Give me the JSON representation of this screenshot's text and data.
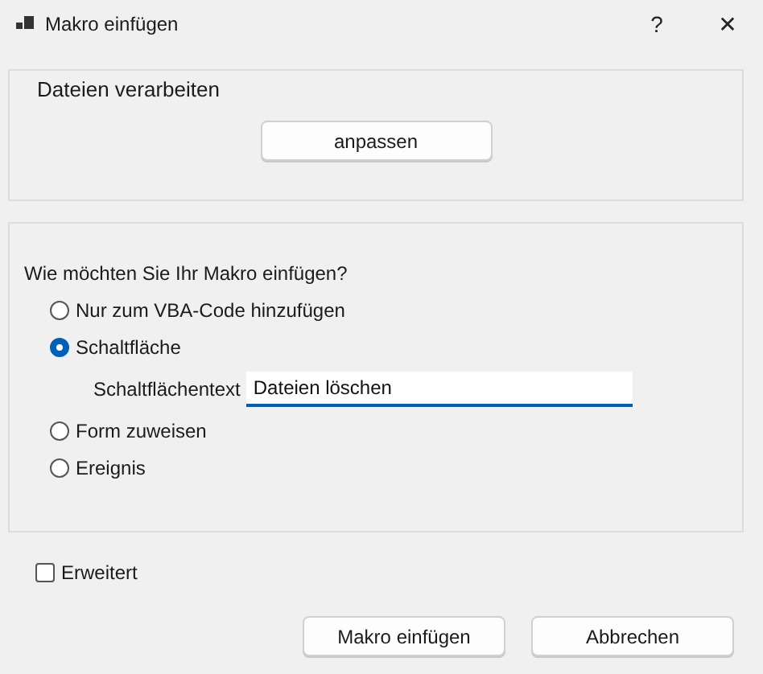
{
  "window": {
    "title": "Makro einfügen",
    "help": "?",
    "close": "✕"
  },
  "group": {
    "title": "Dateien verarbeiten",
    "button": "anpassen"
  },
  "placement": {
    "question": "Wie möchten Sie Ihr Makro einfügen?",
    "options": [
      {
        "label": "Nur zum VBA-Code hinzufügen",
        "selected": false
      },
      {
        "label": "Schaltfläche",
        "selected": true,
        "field": {
          "label": "Schaltflächentext",
          "value": "Dateien löschen"
        }
      },
      {
        "label": "Form zuweisen",
        "selected": false
      },
      {
        "label": "Ereignis",
        "selected": false
      }
    ]
  },
  "advanced": {
    "label": "Erweitert",
    "checked": false
  },
  "buttons": [
    "Makro einfügen",
    "Abbrechen"
  ]
}
